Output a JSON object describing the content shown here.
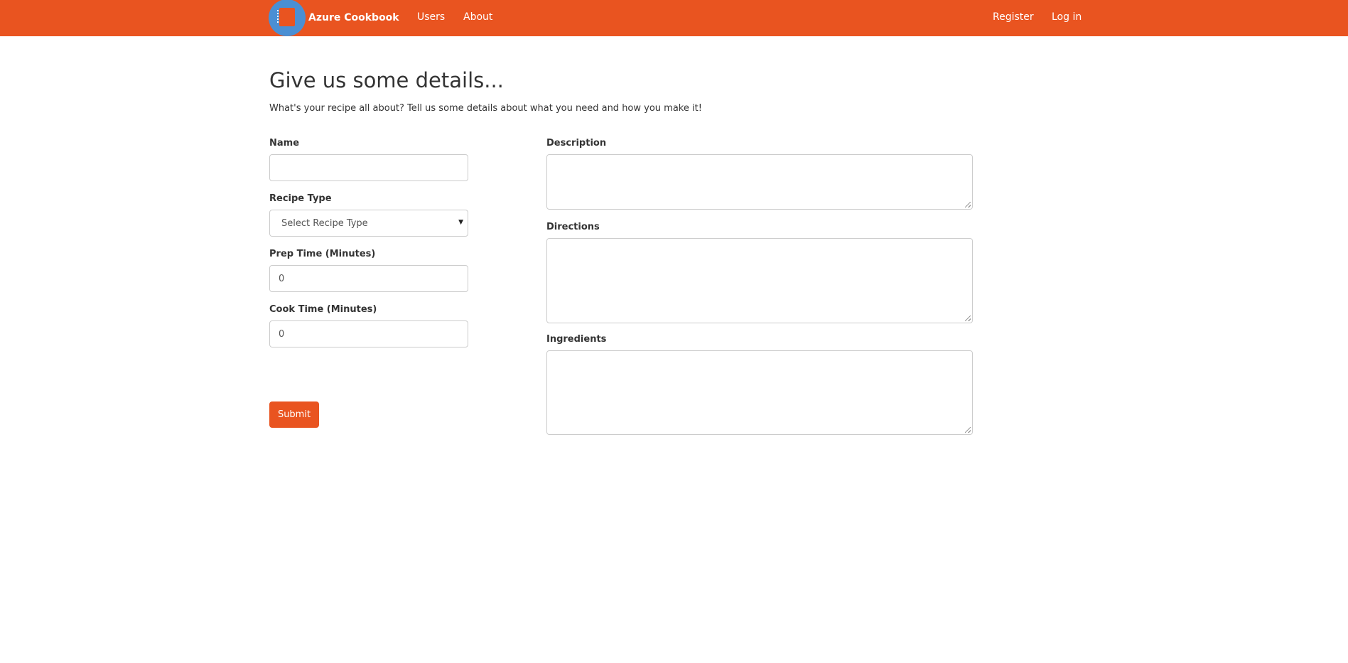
{
  "navbar": {
    "brand_name": "Azure Cookbook",
    "brand_icon": "notebook-icon",
    "links_left": [
      "Users",
      "About"
    ],
    "links_right": [
      "Register",
      "Log in"
    ],
    "bg_color": "#e95420"
  },
  "page": {
    "title": "Give us some details...",
    "subtitle": "What's your recipe all about? Tell us some details about what you need and how you make it!"
  },
  "form": {
    "name": {
      "label": "Name",
      "value": ""
    },
    "recipe_type": {
      "label": "Recipe Type",
      "selected": "Select Recipe Type"
    },
    "prep_time": {
      "label": "Prep Time (Minutes)",
      "value": "0"
    },
    "cook_time": {
      "label": "Cook Time (Minutes)",
      "value": "0"
    },
    "description": {
      "label": "Description",
      "value": ""
    },
    "directions": {
      "label": "Directions",
      "value": ""
    },
    "ingredients": {
      "label": "Ingredients",
      "value": ""
    },
    "submit_label": "Submit"
  }
}
